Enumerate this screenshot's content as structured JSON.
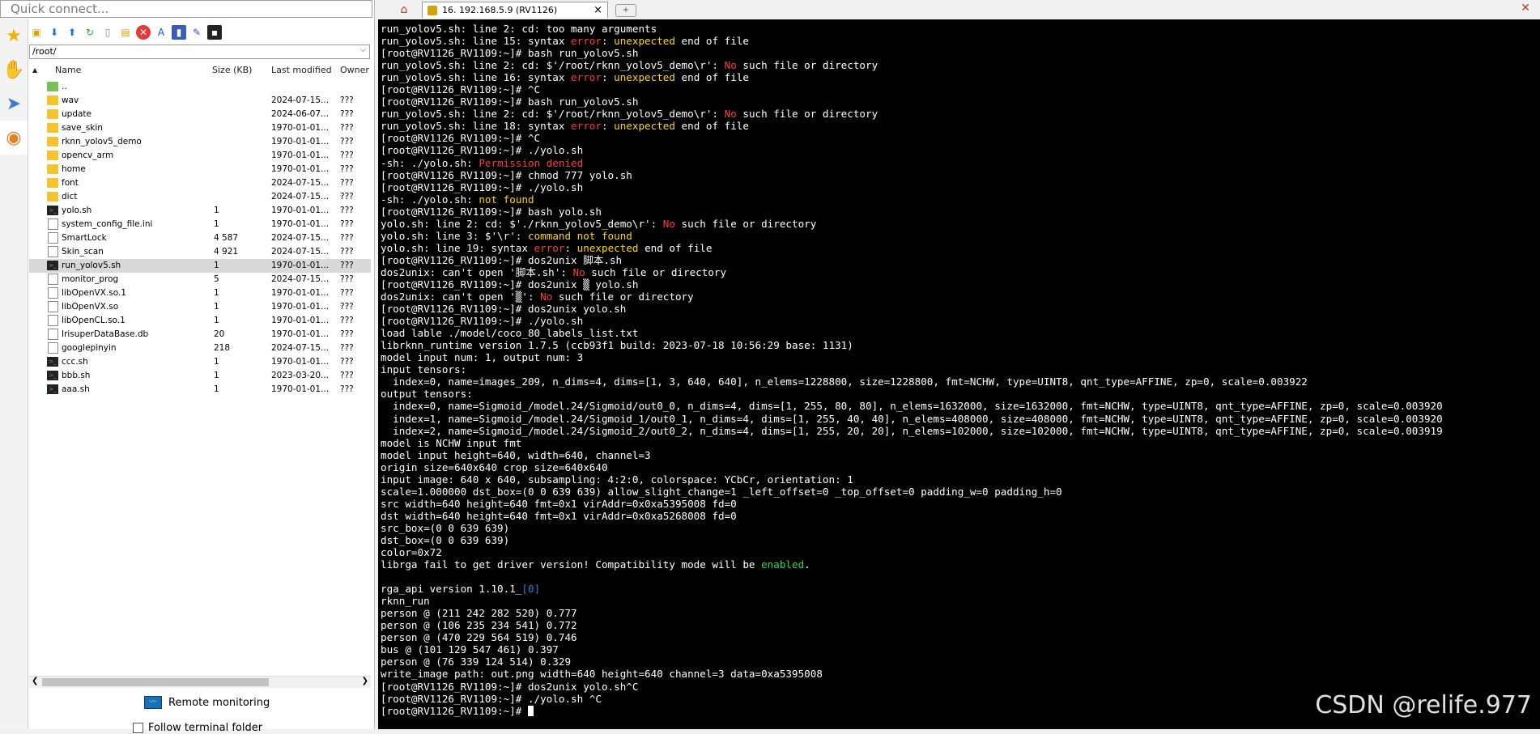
{
  "quick_connect": {
    "placeholder": "Quick connect..."
  },
  "sidebar": {
    "rail": [
      {
        "icon": "star-icon"
      },
      {
        "icon": "macro-icon"
      },
      {
        "icon": "send-icon"
      },
      {
        "icon": "sftp-icon"
      }
    ],
    "toolbar": [
      "new-folder-icon",
      "download-icon",
      "upload-icon",
      "refresh-icon",
      "new-file-icon",
      "open-folder-icon",
      "delete-icon",
      "rename-icon",
      "select-all-icon",
      "properties-icon",
      "terminal-icon"
    ],
    "path": "/root/",
    "columns": {
      "name": "Name",
      "size": "Size (KB)",
      "modified": "Last modified",
      "owner": "Owner"
    },
    "files": [
      {
        "type": "up",
        "name": "..",
        "size": "",
        "modified": "",
        "owner": ""
      },
      {
        "type": "folder",
        "name": "wav",
        "size": "",
        "modified": "2024-07-15...",
        "owner": "???"
      },
      {
        "type": "folder",
        "name": "update",
        "size": "",
        "modified": "2024-06-07...",
        "owner": "???"
      },
      {
        "type": "folder",
        "name": "save_skin",
        "size": "",
        "modified": "1970-01-01...",
        "owner": "???"
      },
      {
        "type": "folder",
        "name": "rknn_yolov5_demo",
        "size": "",
        "modified": "1970-01-01...",
        "owner": "???"
      },
      {
        "type": "folder",
        "name": "opencv_arm",
        "size": "",
        "modified": "1970-01-01...",
        "owner": "???"
      },
      {
        "type": "folder",
        "name": "home",
        "size": "",
        "modified": "1970-01-01...",
        "owner": "???"
      },
      {
        "type": "folder",
        "name": "font",
        "size": "",
        "modified": "2024-07-15...",
        "owner": "???"
      },
      {
        "type": "folder",
        "name": "dict",
        "size": "",
        "modified": "2024-07-15...",
        "owner": "???"
      },
      {
        "type": "shell",
        "name": "yolo.sh",
        "size": "1",
        "modified": "1970-01-01...",
        "owner": "???"
      },
      {
        "type": "file",
        "name": "system_config_file.ini",
        "size": "1",
        "modified": "1970-01-01...",
        "owner": "???"
      },
      {
        "type": "file",
        "name": "SmartLock",
        "size": "4 587",
        "modified": "2024-07-15...",
        "owner": "???"
      },
      {
        "type": "file",
        "name": "Skin_scan",
        "size": "4 921",
        "modified": "2024-07-15...",
        "owner": "???"
      },
      {
        "type": "shell",
        "name": "run_yolov5.sh",
        "size": "1",
        "modified": "1970-01-01...",
        "owner": "???",
        "selected": true
      },
      {
        "type": "file",
        "name": "monitor_prog",
        "size": "5",
        "modified": "2024-07-15...",
        "owner": "???"
      },
      {
        "type": "file",
        "name": "libOpenVX.so.1",
        "size": "1",
        "modified": "1970-01-01...",
        "owner": "???"
      },
      {
        "type": "file",
        "name": "libOpenVX.so",
        "size": "1",
        "modified": "1970-01-01...",
        "owner": "???"
      },
      {
        "type": "file",
        "name": "libOpenCL.so.1",
        "size": "1",
        "modified": "1970-01-01...",
        "owner": "???"
      },
      {
        "type": "file",
        "name": "IrisuperDataBase.db",
        "size": "20",
        "modified": "1970-01-01...",
        "owner": "???"
      },
      {
        "type": "file",
        "name": "googlepinyin",
        "size": "218",
        "modified": "2024-07-15...",
        "owner": "???"
      },
      {
        "type": "shell",
        "name": "ccc.sh",
        "size": "1",
        "modified": "1970-01-01...",
        "owner": "???"
      },
      {
        "type": "shell",
        "name": "bbb.sh",
        "size": "1",
        "modified": "2023-03-20...",
        "owner": "???"
      },
      {
        "type": "shell",
        "name": "aaa.sh",
        "size": "1",
        "modified": "1970-01-01...",
        "owner": "???"
      }
    ],
    "remote_monitoring": "Remote monitoring",
    "follow_terminal": "Follow terminal folder"
  },
  "tabs": [
    {
      "label": "16. 192.168.5.9 (RV1126)",
      "active": true
    }
  ],
  "terminal": {
    "lines": [
      [
        [
          "run_yolov5.sh: line 2: cd: too many arguments",
          ""
        ]
      ],
      [
        [
          "run_yolov5.sh: line 15: syntax ",
          ""
        ],
        [
          "error",
          "red"
        ],
        [
          ": ",
          ""
        ],
        [
          "unexpected",
          "yel"
        ],
        [
          " end of file",
          ""
        ]
      ],
      [
        [
          "[root@RV1126_RV1109:~]# bash run_yolov5.sh",
          ""
        ]
      ],
      [
        [
          "run_yolov5.sh: line 2: cd: $'/root/rknn_yolov5_demo\\r': ",
          ""
        ],
        [
          "No",
          "red"
        ],
        [
          " such file or directory",
          ""
        ]
      ],
      [
        [
          "run_yolov5.sh: line 16: syntax ",
          ""
        ],
        [
          "error",
          "red"
        ],
        [
          ": ",
          ""
        ],
        [
          "unexpected",
          "yel"
        ],
        [
          " end of file",
          ""
        ]
      ],
      [
        [
          "[root@RV1126_RV1109:~]# ^C",
          ""
        ]
      ],
      [
        [
          "[root@RV1126_RV1109:~]# bash run_yolov5.sh",
          ""
        ]
      ],
      [
        [
          "run_yolov5.sh: line 2: cd: $'/root/rknn_yolov5_demo\\r': ",
          ""
        ],
        [
          "No",
          "red"
        ],
        [
          " such file or directory",
          ""
        ]
      ],
      [
        [
          "run_yolov5.sh: line 18: syntax ",
          ""
        ],
        [
          "error",
          "red"
        ],
        [
          ": ",
          ""
        ],
        [
          "unexpected",
          "yel"
        ],
        [
          " end of file",
          ""
        ]
      ],
      [
        [
          "[root@RV1126_RV1109:~]# ^C",
          ""
        ]
      ],
      [
        [
          "[root@RV1126_RV1109:~]# ./yolo.sh",
          ""
        ]
      ],
      [
        [
          "-sh: ./yolo.sh: ",
          ""
        ],
        [
          "Permission denied",
          "red"
        ]
      ],
      [
        [
          "[root@RV1126_RV1109:~]# chmod 777 yolo.sh",
          ""
        ]
      ],
      [
        [
          "[root@RV1126_RV1109:~]# ./yolo.sh",
          ""
        ]
      ],
      [
        [
          "-sh: ./yolo.sh: ",
          ""
        ],
        [
          "not found",
          "yel"
        ]
      ],
      [
        [
          "[root@RV1126_RV1109:~]# bash yolo.sh",
          ""
        ]
      ],
      [
        [
          "yolo.sh: line 2: cd: $'./rknn_yolov5_demo\\r': ",
          ""
        ],
        [
          "No",
          "red"
        ],
        [
          " such file or directory",
          ""
        ]
      ],
      [
        [
          "yolo.sh: line 3: $'\\r': ",
          ""
        ],
        [
          "command not found",
          "yel"
        ]
      ],
      [
        [
          "yolo.sh: line 19: syntax ",
          ""
        ],
        [
          "error",
          "red"
        ],
        [
          ": ",
          ""
        ],
        [
          "unexpected",
          "yel"
        ],
        [
          " end of file",
          ""
        ]
      ],
      [
        [
          "[root@RV1126_RV1109:~]# dos2unix 脚本.sh",
          ""
        ]
      ],
      [
        [
          "dos2unix: can't open '脚本.sh': ",
          ""
        ],
        [
          "No",
          "red"
        ],
        [
          " such file or directory",
          ""
        ]
      ],
      [
        [
          "[root@RV1126_RV1109:~]# dos2unix ▒ yolo.sh",
          ""
        ]
      ],
      [
        [
          "dos2unix: can't open '▒': ",
          ""
        ],
        [
          "No",
          "red"
        ],
        [
          " such file or directory",
          ""
        ]
      ],
      [
        [
          "[root@RV1126_RV1109:~]# dos2unix yolo.sh",
          ""
        ]
      ],
      [
        [
          "[root@RV1126_RV1109:~]# ./yolo.sh",
          ""
        ]
      ],
      [
        [
          "load lable ./model/coco_80_labels_list.txt",
          ""
        ]
      ],
      [
        [
          "librknn_runtime version 1.7.5 (ccb93f1 build: 2023-07-18 10:56:29 base: 1131)",
          ""
        ]
      ],
      [
        [
          "model input num: 1, output num: 3",
          ""
        ]
      ],
      [
        [
          "input tensors:",
          ""
        ]
      ],
      [
        [
          "  index=0, name=images_209, n_dims=4, dims=[1, 3, 640, 640], n_elems=1228800, size=1228800, fmt=NCHW, type=UINT8, qnt_type=AFFINE, zp=0, scale=0.003922",
          ""
        ]
      ],
      [
        [
          "output tensors:",
          ""
        ]
      ],
      [
        [
          "  index=0, name=Sigmoid_/model.24/Sigmoid/out0_0, n_dims=4, dims=[1, 255, 80, 80], n_elems=1632000, size=1632000, fmt=NCHW, type=UINT8, qnt_type=AFFINE, zp=0, scale=0.003920",
          ""
        ]
      ],
      [
        [
          "  index=1, name=Sigmoid_/model.24/Sigmoid_1/out0_1, n_dims=4, dims=[1, 255, 40, 40], n_elems=408000, size=408000, fmt=NCHW, type=UINT8, qnt_type=AFFINE, zp=0, scale=0.003920",
          ""
        ]
      ],
      [
        [
          "  index=2, name=Sigmoid_/model.24/Sigmoid_2/out0_2, n_dims=4, dims=[1, 255, 20, 20], n_elems=102000, size=102000, fmt=NCHW, type=UINT8, qnt_type=AFFINE, zp=0, scale=0.003919",
          ""
        ]
      ],
      [
        [
          "model is NCHW input fmt",
          ""
        ]
      ],
      [
        [
          "model input height=640, width=640, channel=3",
          ""
        ]
      ],
      [
        [
          "origin size=640x640 crop size=640x640",
          ""
        ]
      ],
      [
        [
          "input image: 640 x 640, subsampling: 4:2:0, colorspace: YCbCr, orientation: 1",
          ""
        ]
      ],
      [
        [
          "scale=1.000000 dst_box=(0 0 639 639) allow_slight_change=1 _left_offset=0 _top_offset=0 padding_w=0 padding_h=0",
          ""
        ]
      ],
      [
        [
          "src width=640 height=640 fmt=0x1 virAddr=0x0xa5395008 fd=0",
          ""
        ]
      ],
      [
        [
          "dst width=640 height=640 fmt=0x1 virAddr=0x0xa5268008 fd=0",
          ""
        ]
      ],
      [
        [
          "src_box=(0 0 639 639)",
          ""
        ]
      ],
      [
        [
          "dst_box=(0 0 639 639)",
          ""
        ]
      ],
      [
        [
          "color=0x72",
          ""
        ]
      ],
      [
        [
          "librga fail to get driver version! Compatibility mode will be ",
          ""
        ],
        [
          "enabled",
          "grn"
        ],
        [
          ".",
          ""
        ]
      ],
      [
        [
          "",
          ""
        ]
      ],
      [
        [
          "rga_api version 1.10.1_",
          ""
        ],
        [
          "[0]",
          "blu"
        ]
      ],
      [
        [
          "rknn_run",
          ""
        ]
      ],
      [
        [
          "person @ (211 242 282 520) 0.777",
          ""
        ]
      ],
      [
        [
          "person @ (106 235 234 541) 0.772",
          ""
        ]
      ],
      [
        [
          "person @ (470 229 564 519) 0.746",
          ""
        ]
      ],
      [
        [
          "bus @ (101 129 547 461) 0.397",
          ""
        ]
      ],
      [
        [
          "person @ (76 339 124 514) 0.329",
          ""
        ]
      ],
      [
        [
          "write_image path: out.png width=640 height=640 channel=3 data=0xa5395008",
          ""
        ]
      ],
      [
        [
          "[root@RV1126_RV1109:~]# dos2unix yolo.sh^C",
          ""
        ]
      ],
      [
        [
          "[root@RV1126_RV1109:~]# ./yolo.sh ^C",
          ""
        ]
      ],
      [
        [
          "[root@RV1126_RV1109:~]# ",
          "",
          "cursor"
        ]
      ]
    ],
    "watermark": "CSDN @relife.977"
  }
}
